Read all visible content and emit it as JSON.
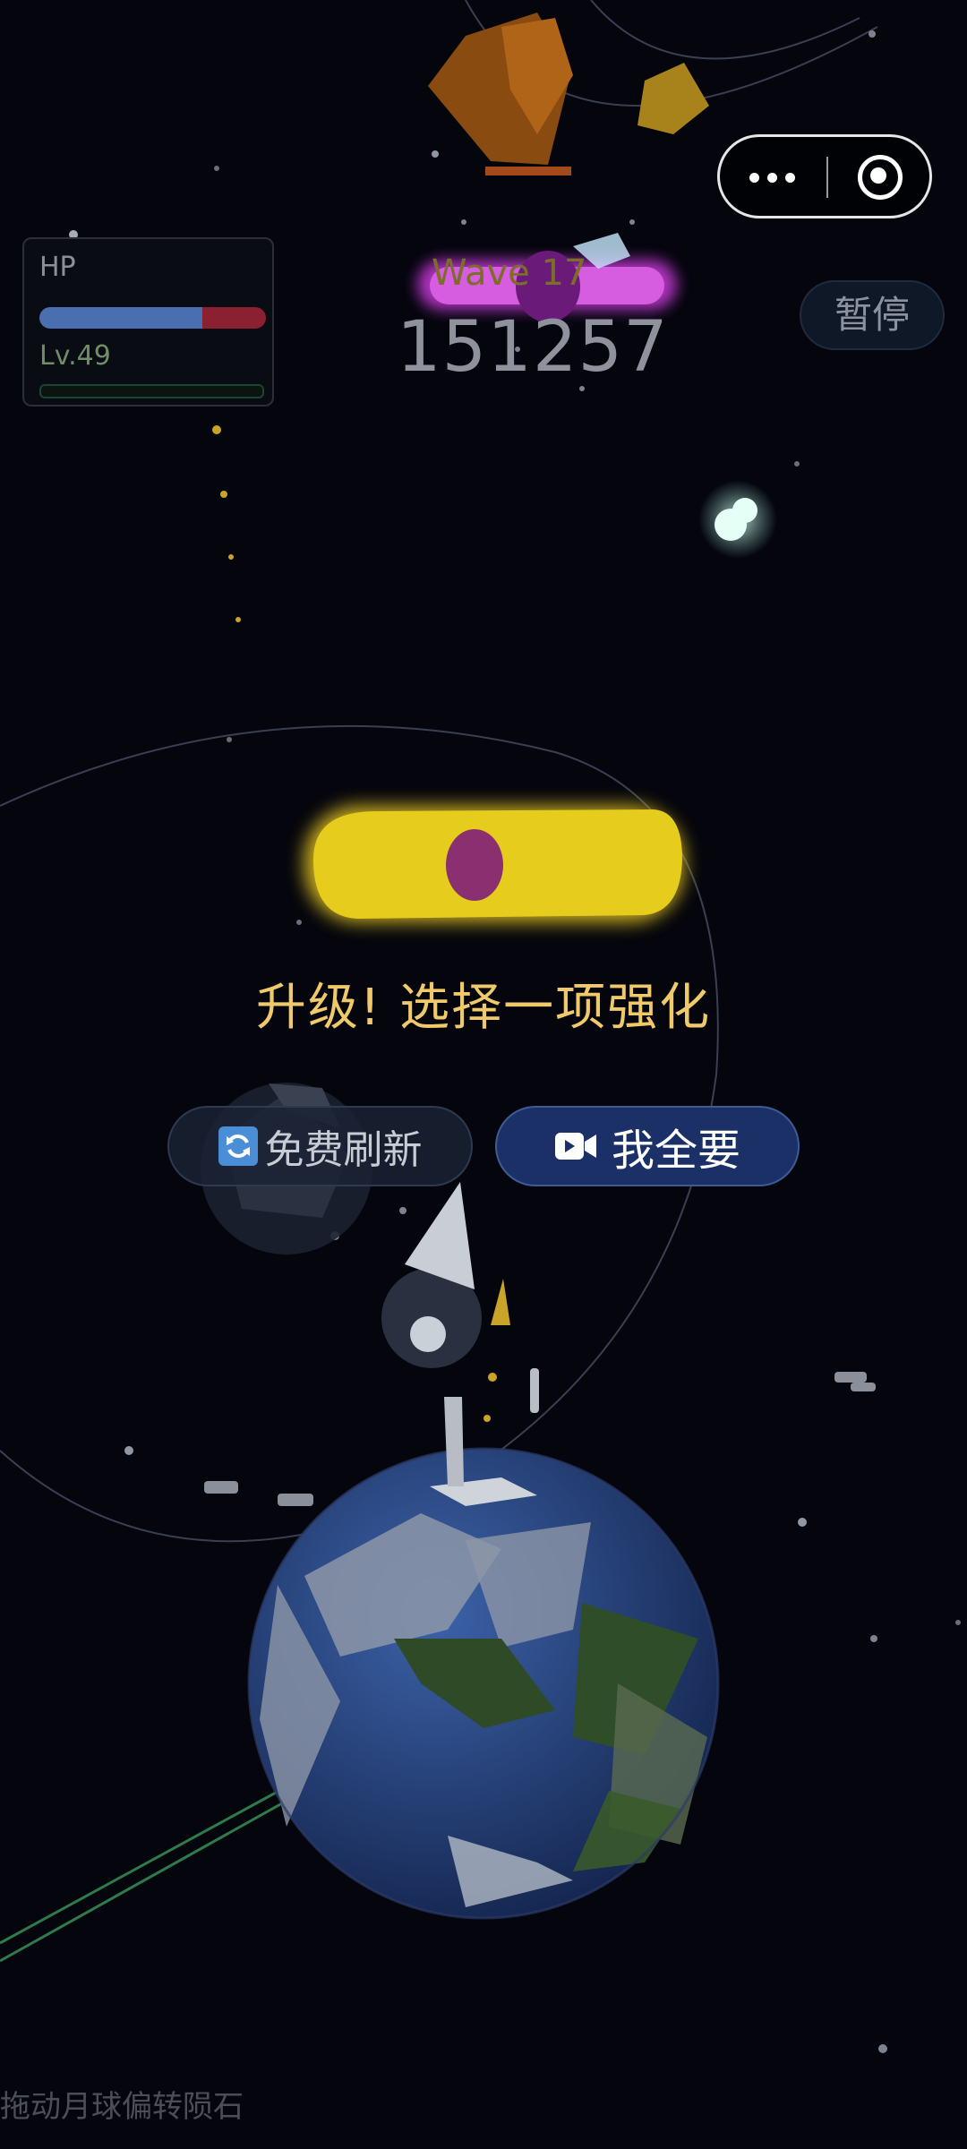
{
  "hud": {
    "hp_label": "HP",
    "hp_fraction": 0.72,
    "level_label": "Lv.49",
    "xp_fraction": 0.0,
    "wave_label": "Wave 17",
    "score": "151257",
    "pause_label": "暂停"
  },
  "upgrade": {
    "title": "升级! 选择一项强化",
    "refresh_label": "免费刷新",
    "all_label": "我全要"
  },
  "hint": "拖动月球偏转陨石",
  "capsule": {
    "more_icon": "more-dots-icon",
    "close_icon": "target-close-icon"
  },
  "colors": {
    "background": "#04050d",
    "gold_text": "#f0c96a",
    "hp_fill": "#4a6fb0",
    "hp_track": "#8b2030",
    "primary_button": "#1c3068"
  }
}
